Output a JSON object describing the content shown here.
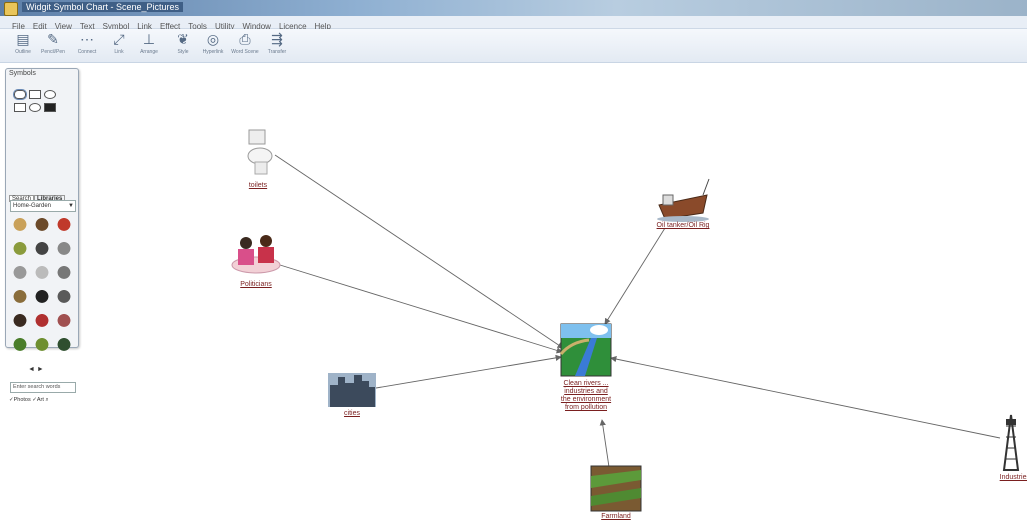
{
  "window": {
    "title": "Widgit Symbol Chart - Scene_Pictures"
  },
  "menu": [
    "File",
    "Edit",
    "View",
    "Text",
    "Symbol",
    "Link",
    "Effect",
    "Tools",
    "Utility",
    "Window",
    "Licence",
    "Help"
  ],
  "toolbar": [
    {
      "label": "Outline",
      "icon": "document-icon"
    },
    {
      "label": "Pencil/Pen",
      "icon": "pen-icon"
    },
    {
      "label": "Connect",
      "icon": "connect-icon"
    },
    {
      "label": "Link",
      "icon": "link-icon"
    },
    {
      "label": "Arrange",
      "icon": "arrange-icon"
    },
    {
      "label": "Style",
      "icon": "style-icon"
    },
    {
      "label": "Hyperlink",
      "icon": "globe-icon"
    },
    {
      "label": "Word Scene",
      "icon": "print-icon"
    },
    {
      "label": "Transfer",
      "icon": "transfer-icon"
    }
  ],
  "symbols_panel": {
    "title": "Symbols",
    "tabs": [
      "Search",
      "Libraries"
    ],
    "library": "Home-Garden",
    "search_placeholder": "Enter search words",
    "filters": [
      "Photos",
      "Art"
    ],
    "nav": "◄ ►"
  },
  "nodes": [
    {
      "id": "toilet",
      "label": "toilets",
      "picture": "toilet"
    },
    {
      "id": "people",
      "label": "Politicians",
      "picture": "people"
    },
    {
      "id": "city",
      "label": "cities",
      "picture": "city"
    },
    {
      "id": "ship",
      "label": "Oil tanker/Oil Rig",
      "picture": "ship"
    },
    {
      "id": "center",
      "label": "Clean rivers ... / industries and / the environment / from pollution",
      "picture": "landscape"
    },
    {
      "id": "farm",
      "label": "Farmland",
      "picture": "farm"
    },
    {
      "id": "tower",
      "label": "Industries",
      "picture": "tower"
    }
  ],
  "colors": {
    "label": "#7a1f1f",
    "link": "#666666",
    "accent": "#3f5f86"
  }
}
